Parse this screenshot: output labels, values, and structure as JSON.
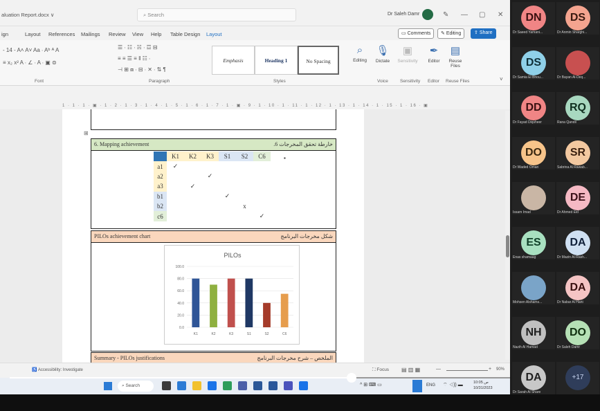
{
  "window": {
    "file_name": "aluation Report.docx ∨",
    "search": "Search",
    "user": "Dr Saleh Damr",
    "min": "—",
    "max": "▢",
    "close": "✕"
  },
  "menu": [
    "ign",
    "Layout",
    "References",
    "Mailings",
    "Review",
    "View",
    "Help",
    "Table Design",
    "Layout"
  ],
  "share": {
    "comments": "Comments",
    "editing": "Editing",
    "share": "Share"
  },
  "ribbon": {
    "font_label": "Font",
    "para_label": "Paragraph",
    "styles_label": "Styles",
    "styles": [
      "Emphasis",
      "Heading 1",
      "No Spacing"
    ],
    "tools": [
      {
        "label": "Editing",
        "icon": "search-icon"
      },
      {
        "label": "Dictate",
        "icon": "microphone-icon"
      },
      {
        "label": "Sensitivity",
        "icon": "sensitivity-icon"
      },
      {
        "label": "Editor",
        "icon": "pen-icon"
      },
      {
        "label": "Reuse Files",
        "icon": "reuse-icon"
      }
    ],
    "groups": [
      "Voice",
      "Sensitivity",
      "Editor",
      "Reuse Files"
    ],
    "font_row1": "-  14  -  A˄  A˅  Aa  ∙  Aᵇ  ᴬ  A",
    "font_row2": "≡  x₂  x²  A ∙  ∠ ∙  A ∙  ▣  ⊜",
    "para_row1": "☰ ∙ ☷ ∙ ☵ ∙  ☲  ⊟",
    "para_row2": "≡  ≡  ☰  ≡  ‖  ☷ ∙",
    "para_row3": "⊣  ⊞  ⧈ ∙  ⊟ ∙  ✕ ∙  ⇅  ¶"
  },
  "ruler": "1 · 1 · 1 · ▣ · 1 · 2 · 1 · 3 · 1 · 4 · 1 · 5 · 1 · 6 · 1 · 7 · 1 · ▣ · 9 · 1 · 10 · 1 · 11 · 1 · 12 · 1 · 13 · 1 · 14 · 1 · 15 · 1 · 16 · ▣",
  "document": {
    "mapping": {
      "title": "6. Mapping achievement",
      "title_ar": ".6 خارطة تحقق المخرجات",
      "bullet": "▪",
      "cols": [
        "K1",
        "K2",
        "K3",
        "S1",
        "S2",
        "C6"
      ],
      "rows": [
        {
          "label": "a1",
          "marks": [
            "✓",
            "",
            "",
            "",
            "",
            ""
          ]
        },
        {
          "label": "a2",
          "marks": [
            "",
            "",
            "✓",
            "",
            "",
            ""
          ]
        },
        {
          "label": "a3",
          "marks": [
            "",
            "✓",
            "",
            "",
            "",
            ""
          ]
        },
        {
          "label": "b1",
          "marks": [
            "",
            "",
            "",
            "✓",
            "",
            ""
          ]
        },
        {
          "label": "b2",
          "marks": [
            "",
            "",
            "",
            "",
            "x",
            ""
          ]
        },
        {
          "label": "c6",
          "marks": [
            "",
            "",
            "",
            "",
            "",
            "✓"
          ]
        }
      ]
    },
    "chart_section": {
      "title": "PILOs achievement chart",
      "title_ar": "شكل مخرجات البرنامج"
    },
    "summary": {
      "title": "Summary - PILOs justifications",
      "title_ar": "الملخص – شرح مخرجات البرنامج"
    }
  },
  "chart_data": {
    "type": "bar",
    "title": "PILOs",
    "categories": [
      "K1",
      "K2",
      "K3",
      "S1",
      "S2",
      "C6"
    ],
    "values": [
      80,
      70,
      80,
      80,
      40,
      55
    ],
    "ylim": [
      0,
      100
    ],
    "yticks": [
      "0.0",
      "20.0",
      "40.0",
      "60.0",
      "80.0",
      "100.0"
    ],
    "colors": [
      "#2f5597",
      "#8fb040",
      "#c0504d",
      "#1f3864",
      "#a53b2a",
      "#e69d4d"
    ],
    "grid": true
  },
  "statusbar": {
    "accessibility": "Accessibility: Investigate",
    "focus": "Focus",
    "zoom": "90%"
  },
  "taskbar": {
    "search": "Search",
    "lang": "ENG",
    "clock": "10:05 ص 10/31/2023"
  },
  "participants": [
    {
      "initials": "DN",
      "name": "Dr Saeed Yamani...",
      "color": "#f08585",
      "text": "#3a1010"
    },
    {
      "initials": "DS",
      "name": "Dr Anmin Sharghi...",
      "color": "#f4a48f",
      "text": "#3a1a10"
    },
    {
      "initials": "DS",
      "name": "Dr Samia El Bhou...",
      "color": "#8fd0e8",
      "text": "#103038"
    },
    {
      "initials": "",
      "name": "Dr Bayan Al-Deq...",
      "color": "#c85050",
      "text": "#fff"
    },
    {
      "initials": "DD",
      "name": "Dr Fayad Diqsheer",
      "color": "#f08585",
      "text": "#3a1010"
    },
    {
      "initials": "RQ",
      "name": "Rana Qandil",
      "color": "#a8d8c0",
      "text": "#103020"
    },
    {
      "initials": "DO",
      "name": "Dr Waded Omari",
      "color": "#f7c48a",
      "text": "#3a2810"
    },
    {
      "initials": "SR",
      "name": "Sabrina Al Rawab...",
      "color": "#f2c8a0",
      "text": "#3a2010"
    },
    {
      "initials": "",
      "name": "Issam Imad",
      "color": "#c9b6a5",
      "text": "#fff"
    },
    {
      "initials": "DE",
      "name": "Dr Ahmed Eid",
      "color": "#f5b9c4",
      "text": "#3a1018"
    },
    {
      "initials": "ES",
      "name": "Enas shamaag",
      "color": "#a8e0c0",
      "text": "#104028"
    },
    {
      "initials": "DA",
      "name": "Dr Mazin Al-Rash...",
      "color": "#cfe0f2",
      "text": "#10203a"
    },
    {
      "initials": "",
      "name": "Mohsen Alshams...",
      "color": "#7aa4c8",
      "text": "#fff"
    },
    {
      "initials": "DA",
      "name": "Dr Nabar Al Harti",
      "color": "#f5c4c4",
      "text": "#3a1010"
    },
    {
      "initials": "NH",
      "name": "Nazih Al Hamad",
      "color": "#c0c0c0",
      "text": "#202020"
    },
    {
      "initials": "DO",
      "name": "Dr Saleh Damr",
      "color": "#b5e0b5",
      "text": "#103010"
    },
    {
      "initials": "DA",
      "name": "Dr Sarah Al Share",
      "color": "#c8c8c8",
      "text": "#202020"
    },
    {
      "initials": "+17",
      "name": "",
      "color": "#2f3d5a",
      "text": "#c8d4f0"
    }
  ]
}
